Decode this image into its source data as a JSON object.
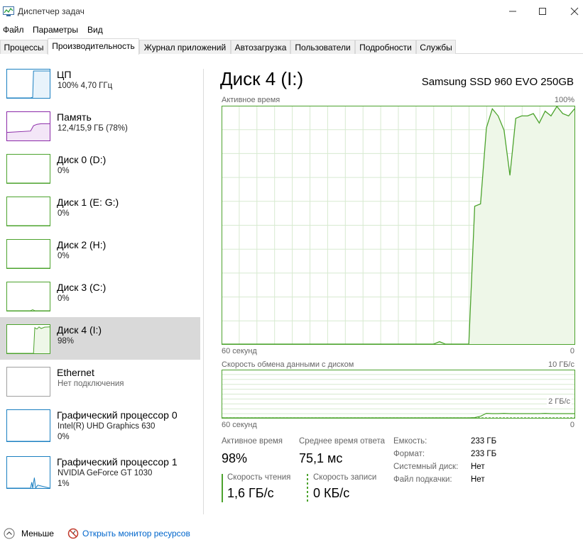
{
  "window": {
    "title": "Диспетчер задач"
  },
  "menu": [
    "Файл",
    "Параметры",
    "Вид"
  ],
  "tabs": [
    "Процессы",
    "Производительность",
    "Журнал приложений",
    "Автозагрузка",
    "Пользователи",
    "Подробности",
    "Службы"
  ],
  "active_tab_index": 1,
  "sidebar": {
    "items": [
      {
        "name": "ЦП",
        "sub1": "100%  4,70 ГГц",
        "sub2": "",
        "color": "#1a7fc1",
        "fill": "#e8f3fb"
      },
      {
        "name": "Память",
        "sub1": "12,4/15,9 ГБ (78%)",
        "sub2": "",
        "color": "#8b2aa8",
        "fill": "#f3e6f7"
      },
      {
        "name": "Диск 0 (D:)",
        "sub1": "0%",
        "sub2": "",
        "color": "#4ca32d",
        "fill": "#eef7e8"
      },
      {
        "name": "Диск 1 (E: G:)",
        "sub1": "0%",
        "sub2": "",
        "color": "#4ca32d",
        "fill": "#eef7e8"
      },
      {
        "name": "Диск 2 (H:)",
        "sub1": "0%",
        "sub2": "",
        "color": "#4ca32d",
        "fill": "#eef7e8"
      },
      {
        "name": "Диск 3 (C:)",
        "sub1": "0%",
        "sub2": "",
        "color": "#4ca32d",
        "fill": "#eef7e8"
      },
      {
        "name": "Диск 4 (I:)",
        "sub1": "98%",
        "sub2": "",
        "color": "#4ca32d",
        "fill": "#eef7e8"
      },
      {
        "name": "Ethernet",
        "sub1": "Нет подключения",
        "sub2": "",
        "color": "#a0a0a0",
        "fill": "#f3f3f3"
      },
      {
        "name": "Графический процессор 0",
        "sub1": "Intel(R) UHD Graphics 630",
        "sub2": "0%",
        "color": "#1a7fc1",
        "fill": "#e8f3fb"
      },
      {
        "name": "Графический процессор 1",
        "sub1": "NVIDIA GeForce GT 1030",
        "sub2": "1%",
        "color": "#1a7fc1",
        "fill": "#e8f3fb"
      }
    ],
    "selected_index": 6
  },
  "main": {
    "title": "Диск 4 (I:)",
    "model": "Samsung SSD 960 EVO 250GB",
    "chart1": {
      "label": "Активное время",
      "max_label": "100%",
      "x_left": "60 секунд",
      "x_right": "0"
    },
    "chart2": {
      "label": "Скорость обмена данными с диском",
      "max_label": "10 ГБ/с",
      "mid_label": "2 ГБ/с",
      "x_left": "60 секунд",
      "x_right": "0"
    },
    "stats": {
      "active_time_label": "Активное время",
      "active_time_value": "98%",
      "avg_response_label": "Среднее время ответа",
      "avg_response_value": "75,1 мс",
      "read_label": "Скорость чтения",
      "read_value": "1,6 ГБ/с",
      "write_label": "Скорость записи",
      "write_value": "0 КБ/с"
    },
    "info": [
      {
        "label": "Емкость:",
        "value": "233 ГБ"
      },
      {
        "label": "Формат:",
        "value": "233 ГБ"
      },
      {
        "label": "Системный диск:",
        "value": "Нет"
      },
      {
        "label": "Файл подкачки:",
        "value": "Нет"
      }
    ]
  },
  "footer": {
    "less_label": "Меньше",
    "monitor_label": "Открыть монитор ресурсов"
  },
  "colors": {
    "disk_line": "#4ca32d",
    "disk_fill": "#eef7e8",
    "grid": "#d7ead0",
    "border": "#4ca32d",
    "link": "#0066cc"
  },
  "chart_data": [
    {
      "type": "area",
      "title": "Активное время",
      "xlabel": "60 секунд",
      "ylabel": "",
      "ylim": [
        0,
        100
      ],
      "x": [
        60,
        59,
        58,
        57,
        56,
        55,
        54,
        53,
        52,
        51,
        50,
        49,
        48,
        47,
        46,
        45,
        44,
        43,
        42,
        41,
        40,
        39,
        38,
        37,
        36,
        35,
        34,
        33,
        32,
        31,
        30,
        29,
        28,
        27,
        26,
        25,
        24,
        23,
        22,
        21,
        20,
        19,
        18,
        17,
        16,
        15,
        14,
        13,
        12,
        11,
        10,
        9,
        8,
        7,
        6,
        5,
        4,
        3,
        2,
        1,
        0
      ],
      "values": [
        0,
        0,
        0,
        0,
        0,
        0,
        0,
        0,
        0,
        0,
        0,
        0,
        0,
        0,
        0,
        0,
        0,
        0,
        0,
        0,
        0,
        0,
        0,
        0,
        0,
        0,
        0,
        0,
        0,
        0,
        0,
        0,
        0,
        0,
        0,
        0,
        0,
        1,
        0,
        0,
        0,
        0,
        0,
        58,
        59,
        91,
        99,
        96,
        90,
        71,
        95,
        96,
        96,
        97,
        93,
        98,
        96,
        100,
        97,
        96,
        99
      ]
    },
    {
      "type": "line",
      "title": "Скорость обмена данными с диском",
      "xlabel": "60 секунд",
      "ylabel": "",
      "ylim": [
        0,
        10
      ],
      "series": [
        {
          "name": "Скорость чтения",
          "values": [
            0,
            0,
            0,
            0,
            0,
            0,
            0,
            0,
            0,
            0,
            0,
            0,
            0,
            0,
            0,
            0,
            0,
            0,
            0,
            0,
            0,
            0,
            0,
            0,
            0,
            0,
            0,
            0,
            0,
            0,
            0,
            0,
            0,
            0,
            0,
            0,
            0,
            0,
            0,
            0,
            0,
            0,
            0,
            0.1,
            0.6,
            1.7,
            1.6,
            1.6,
            1.7,
            1.6,
            1.6,
            1.6,
            1.6,
            1.6,
            1.6,
            1.7,
            1.6,
            1.6,
            1.6,
            1.6,
            1.6
          ]
        },
        {
          "name": "Скорость записи",
          "values": [
            0,
            0,
            0,
            0,
            0,
            0,
            0,
            0,
            0,
            0,
            0,
            0,
            0,
            0,
            0,
            0,
            0,
            0,
            0,
            0,
            0,
            0,
            0,
            0,
            0,
            0,
            0,
            0,
            0,
            0,
            0,
            0,
            0,
            0,
            0,
            0,
            0,
            0,
            0,
            0,
            0,
            0,
            0,
            0,
            0,
            0,
            0,
            0,
            0,
            0,
            0,
            0,
            0,
            0,
            0,
            0,
            0,
            0,
            0,
            0,
            0
          ]
        }
      ]
    }
  ]
}
